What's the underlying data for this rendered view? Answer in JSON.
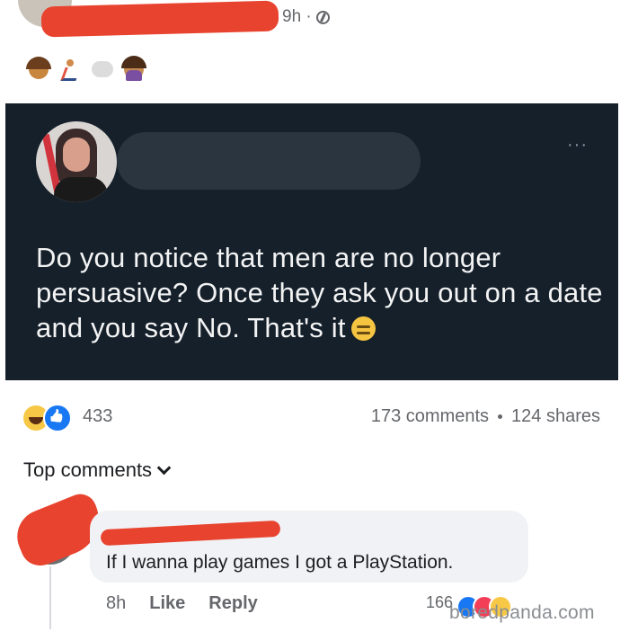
{
  "post": {
    "time": "9h ·",
    "privacy_icon": "globe-icon",
    "emojis": [
      "woman-face-emoji",
      "running-person-emoji",
      "dash-emoji",
      "facepalm-emoji"
    ]
  },
  "tweet": {
    "text": "Do you notice that men are no longer persuasive? Once they ask you out on a date and you say No. That's it",
    "trailing_emoji": "expressionless-face-emoji",
    "more_label": "···",
    "background": "#15202b"
  },
  "engagement": {
    "reactions_count": "433",
    "comments": "173 comments",
    "shares": "124 shares"
  },
  "comments_section": {
    "sort_label": "Top comments"
  },
  "comment": {
    "text": "If I wanna play games I got a PlayStation.",
    "time": "8h",
    "like_label": "Like",
    "reply_label": "Reply",
    "reaction_count": "166"
  },
  "watermark": "boredpanda.com",
  "colors": {
    "redaction": "#e8432e",
    "like_blue": "#1877f2",
    "secondary_text": "#65676b"
  }
}
